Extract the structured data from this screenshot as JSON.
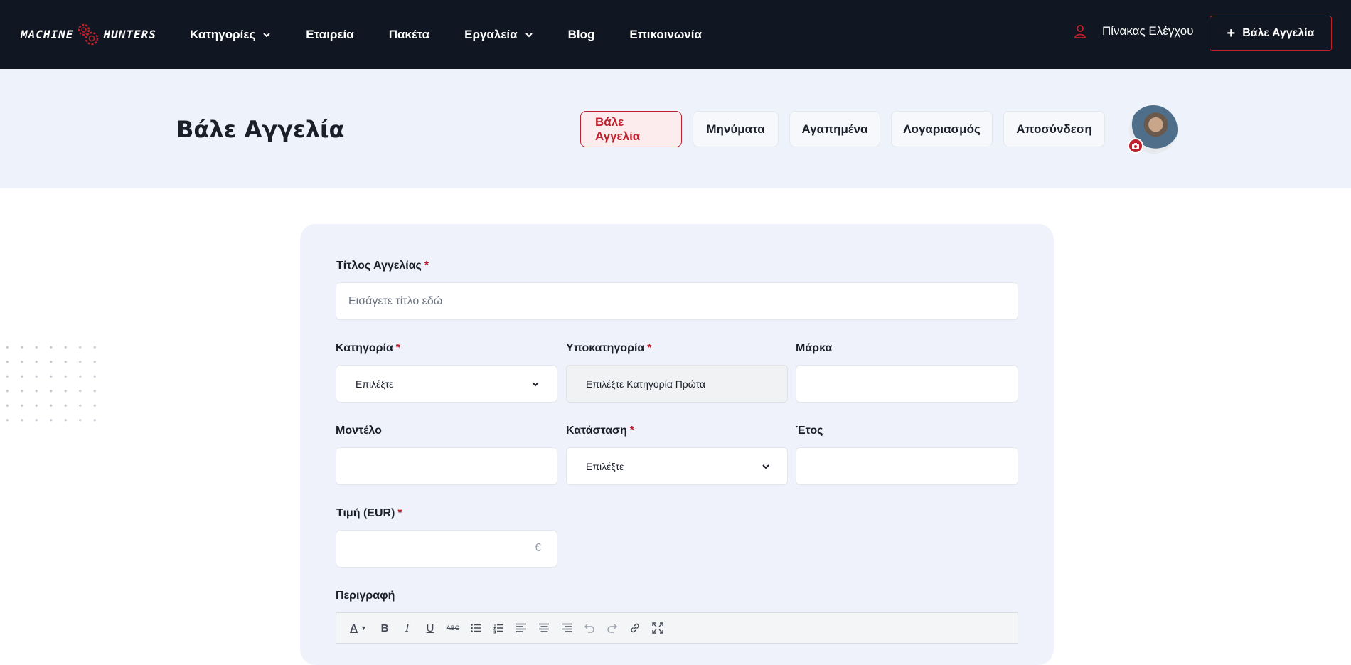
{
  "brand": {
    "logo_left": "MACHINE",
    "logo_right": "HUNTERS",
    "accent": "#c0202c",
    "nav_bg": "#111722"
  },
  "nav": {
    "items": [
      {
        "label": "Κατηγορίες",
        "has_dropdown": true
      },
      {
        "label": "Εταιρεία",
        "has_dropdown": false
      },
      {
        "label": "Πακέτα",
        "has_dropdown": false
      },
      {
        "label": "Εργαλεία",
        "has_dropdown": true
      },
      {
        "label": "Blog",
        "has_dropdown": false
      },
      {
        "label": "Επικοινωνία",
        "has_dropdown": false
      }
    ],
    "dashboard_label": "Πίνακας Ελέγχου",
    "post_button_label": "Βάλε Αγγελία"
  },
  "subheader": {
    "title": "Βάλε Αγγελία",
    "tabs": [
      {
        "label": "Βάλε Αγγελία",
        "active": true
      },
      {
        "label": "Μηνύματα",
        "active": false
      },
      {
        "label": "Αγαπημένα",
        "active": false
      },
      {
        "label": "Λογαριασμός",
        "active": false
      },
      {
        "label": "Αποσύνδεση",
        "active": false
      }
    ]
  },
  "form": {
    "title_label": "Τίτλος Αγγελίας",
    "title_placeholder": "Εισάγετε τίτλο εδώ",
    "category_label": "Κατηγορία",
    "category_value": "Επιλέξτε",
    "subcategory_label": "Υποκατηγορία",
    "subcategory_value": "Επιλέξτε Κατηγορία Πρώτα",
    "brand_label": "Μάρκα",
    "model_label": "Μοντέλο",
    "condition_label": "Κατάσταση",
    "condition_value": "Επιλέξτε",
    "year_label": "Έτος",
    "price_label": "Τιμή (EUR)",
    "price_currency": "€",
    "description_label": "Περιγραφή",
    "required_mark": "*"
  },
  "editor_toolbar": {
    "icons": [
      "font-color-icon",
      "bold-icon",
      "italic-icon",
      "underline-icon",
      "strikethrough-icon",
      "bullet-list-icon",
      "numbered-list-icon",
      "align-left-icon",
      "align-center-icon",
      "align-right-icon",
      "undo-icon",
      "redo-icon",
      "link-icon",
      "fullscreen-icon"
    ],
    "bold_glyph": "B",
    "italic_glyph": "I",
    "underline_glyph": "U",
    "strike_glyph": "ABC",
    "font_glyph": "A"
  }
}
